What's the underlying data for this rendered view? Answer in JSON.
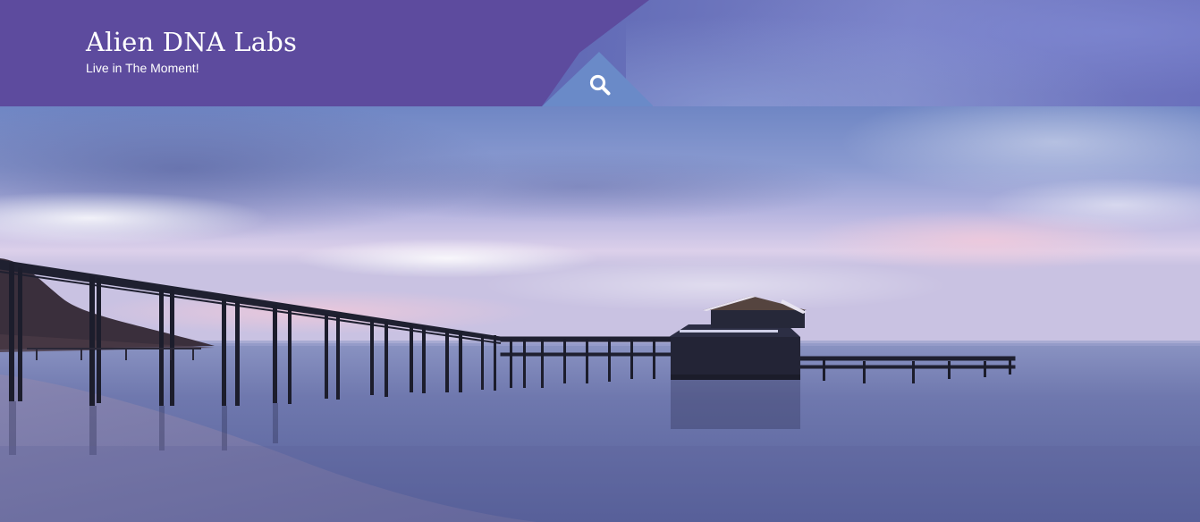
{
  "site": {
    "title": "Alien DNA Labs",
    "tagline": "Live in The Moment!"
  },
  "header": {
    "search_icon": "search-icon",
    "panel_color": "#5d4b9e"
  },
  "hero": {
    "image": "pier-boathouse-at-dusk"
  }
}
